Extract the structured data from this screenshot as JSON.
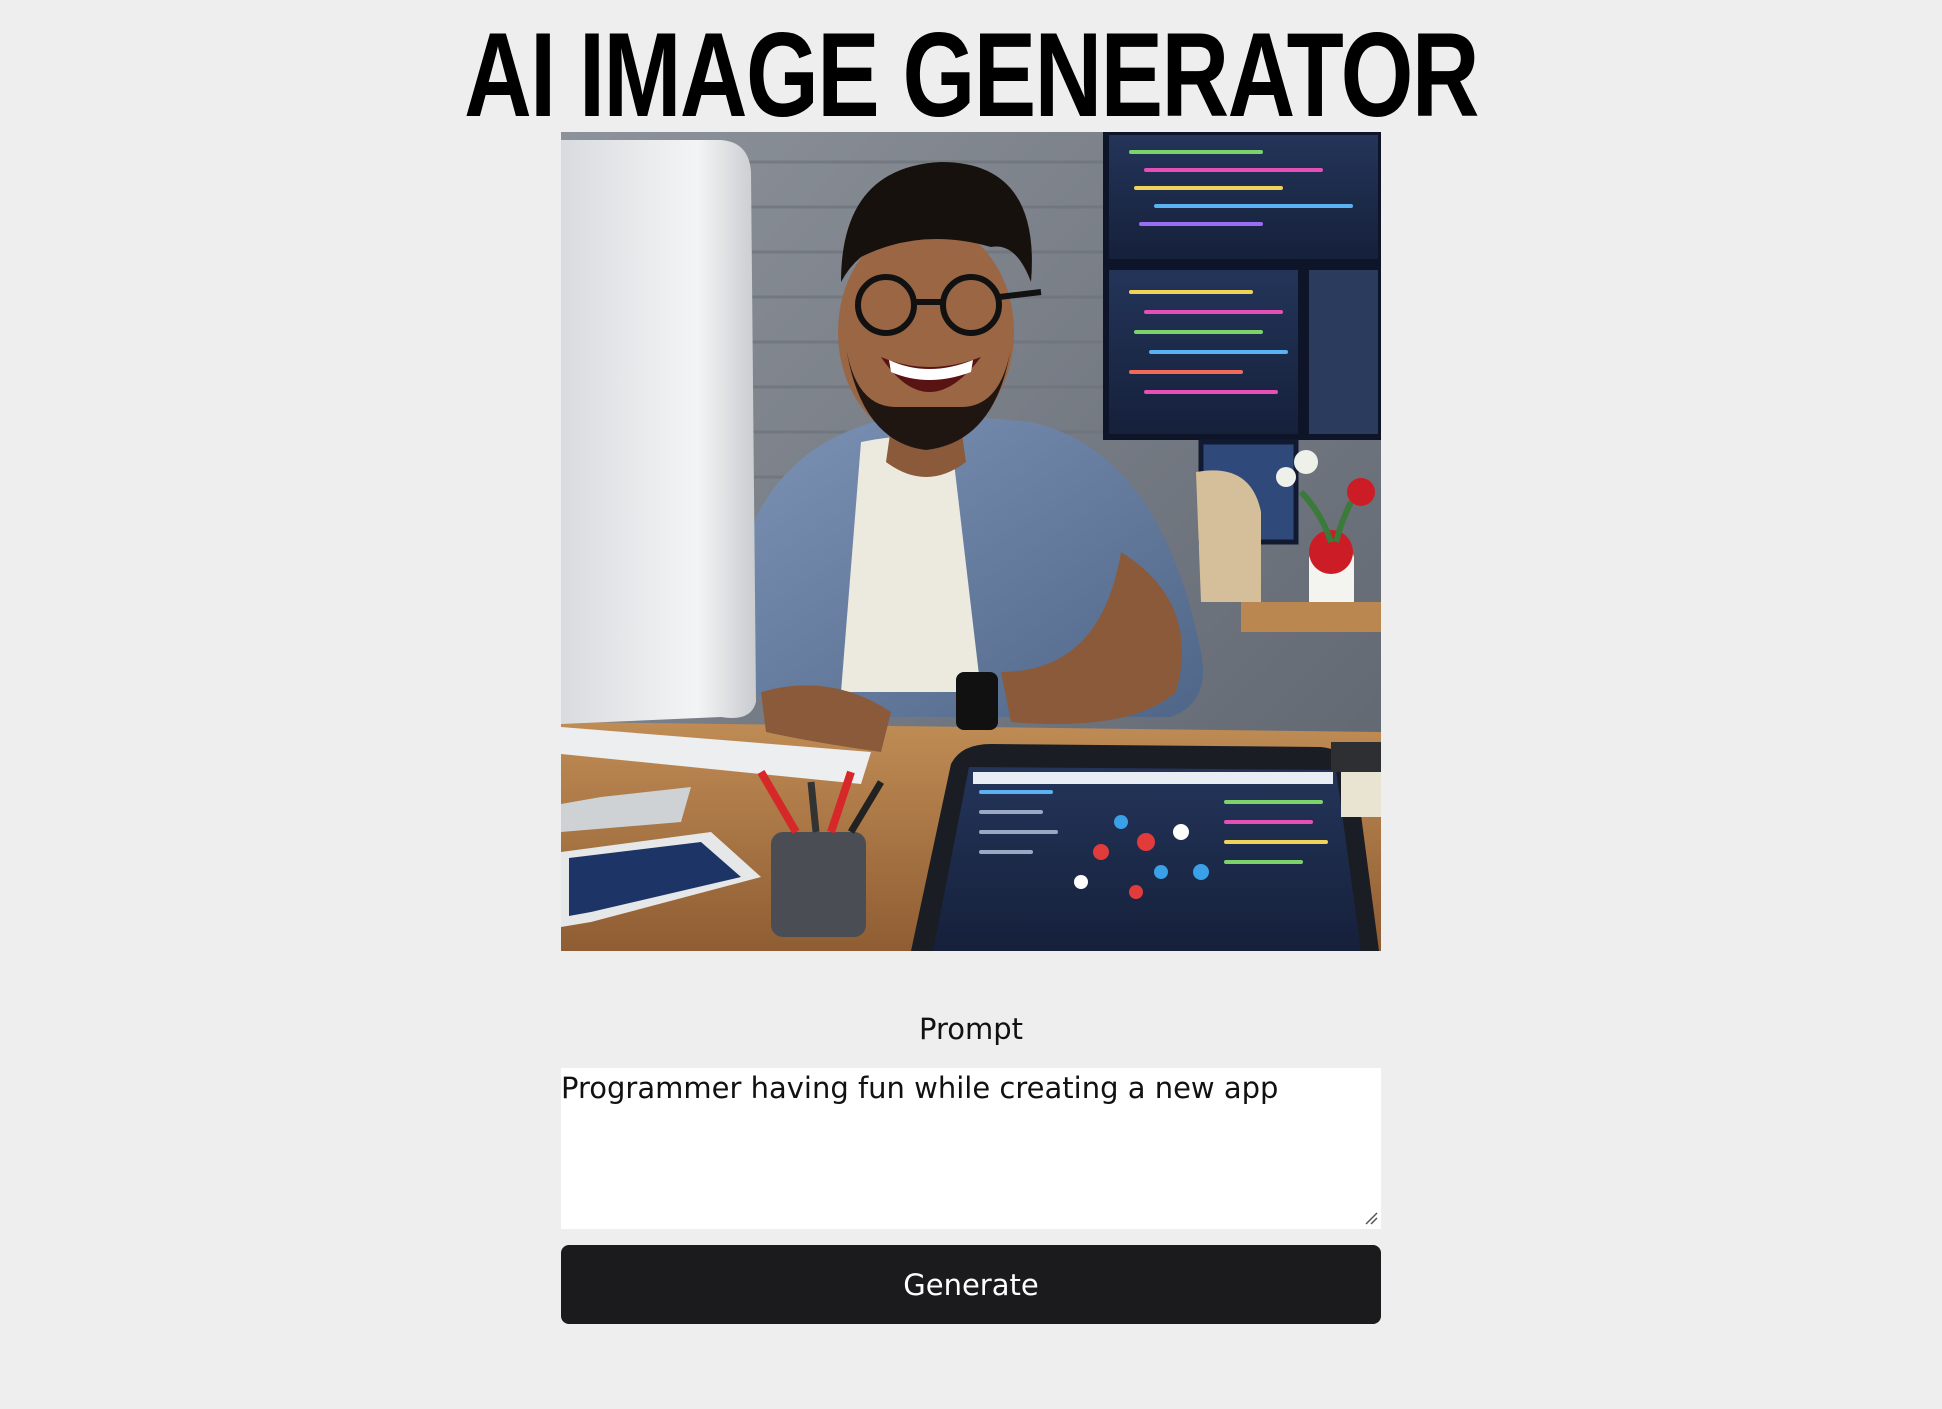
{
  "header": {
    "title": "AI IMAGE GENERATOR"
  },
  "generated_image": {
    "alt": "Generated image of a smiling programmer at a desk with computers"
  },
  "form": {
    "prompt_label": "Prompt",
    "prompt_value": "Programmer having fun while creating a new app",
    "generate_label": "Generate"
  },
  "colors": {
    "background": "#eeeeee",
    "button": "#1b1b1d",
    "button_text": "#ffffff"
  }
}
